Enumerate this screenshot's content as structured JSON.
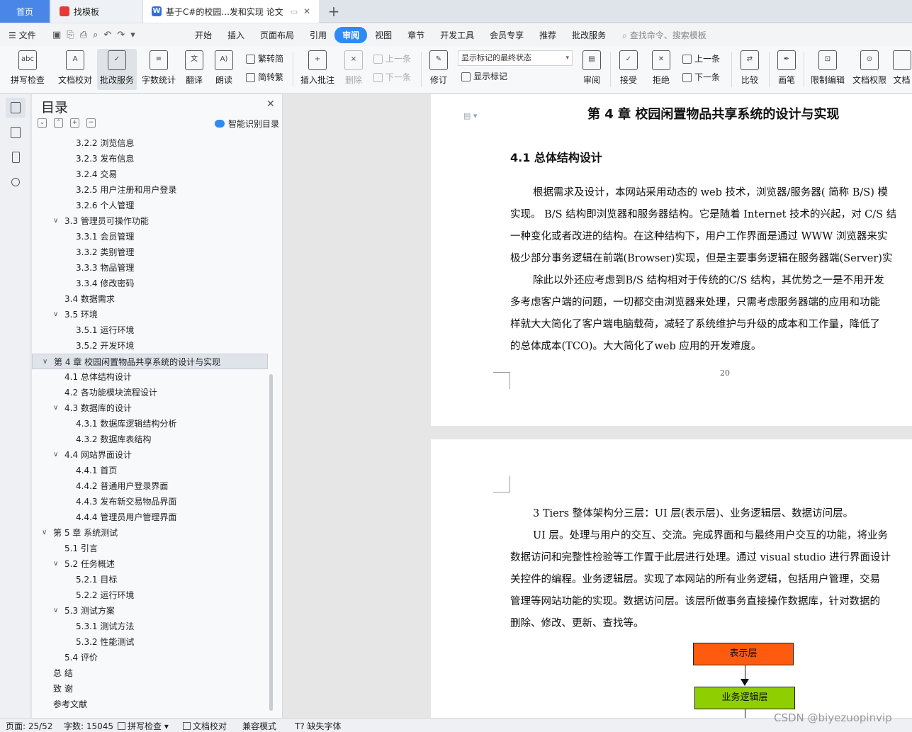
{
  "tabs": {
    "home": "首页",
    "template": "找模板",
    "document": "基于C#的校园...发和实现 论文"
  },
  "menubar": {
    "file": "文件",
    "items": [
      "开始",
      "插入",
      "页面布局",
      "引用",
      "审阅",
      "视图",
      "章节",
      "开发工具",
      "会员专享",
      "推荐",
      "批改服务"
    ],
    "active": "审阅",
    "search_placeholder": "查找命令、搜索模板"
  },
  "ribbon": {
    "spellcheck": "拼写检查",
    "doc_proof": "文档校对",
    "correct_service": "批改服务",
    "word_count": "字数统计",
    "translate": "翻译",
    "read_aloud": "朗读",
    "trad_conv": "繁转简",
    "simp_conv": "简转繁",
    "insert_comment": "插入批注",
    "delete": "删除",
    "prev_comment": "上一条",
    "next_comment": "下一条",
    "track": "修订",
    "markup_select": "显示标记的最终状态",
    "show_markup": "显示标记",
    "review": "审阅",
    "accept": "接受",
    "reject": "拒绝",
    "prev": "上一条",
    "next": "下一条",
    "compare": "比较",
    "pen": "画笔",
    "restrict_edit": "限制编辑",
    "doc_permission": "文档权限",
    "doc_more": "文档"
  },
  "toc": {
    "title": "目录",
    "smart": "智能识别目录",
    "items": [
      {
        "label": "3.2.2 浏览信息",
        "level": 3
      },
      {
        "label": "3.2.3 发布信息",
        "level": 3
      },
      {
        "label": "3.2.4  交易",
        "level": 3
      },
      {
        "label": "3.2.5 用户注册和用户登录",
        "level": 3
      },
      {
        "label": "3.2.6 个人管理",
        "level": 3
      },
      {
        "label": "3.3 管理员可操作功能",
        "level": 2,
        "expand": true
      },
      {
        "label": "3.3.1 会员管理",
        "level": 3
      },
      {
        "label": "3.3.2 类别管理",
        "level": 3
      },
      {
        "label": "3.3.3 物品管理",
        "level": 3
      },
      {
        "label": "3.3.4  修改密码",
        "level": 3
      },
      {
        "label": "3.4 数据需求",
        "level": 2
      },
      {
        "label": "3.5 环境",
        "level": 2,
        "expand": true
      },
      {
        "label": "3.5.1 运行环境",
        "level": 3
      },
      {
        "label": "3.5.2 开发环境",
        "level": 3
      },
      {
        "label": "第 4 章  校园闲置物品共享系统的设计与实现",
        "level": 1,
        "expand": true,
        "selected": true
      },
      {
        "label": "4.1 总体结构设计",
        "level": 2
      },
      {
        "label": "4.2 各功能模块流程设计",
        "level": 2
      },
      {
        "label": "4.3 数据库的设计",
        "level": 2,
        "expand": true
      },
      {
        "label": "4.3.1 数据库逻辑结构分析",
        "level": 3
      },
      {
        "label": "4.3.2 数据库表结构",
        "level": 3
      },
      {
        "label": "4.4 网站界面设计",
        "level": 2,
        "expand": true
      },
      {
        "label": "4.4.1 首页",
        "level": 3
      },
      {
        "label": "4.4.2 普通用户登录界面",
        "level": 3
      },
      {
        "label": "4.4.3 发布新交易物品界面",
        "level": 3
      },
      {
        "label": "4.4.4 管理员用户管理界面",
        "level": 3
      },
      {
        "label": "第 5 章  系统测试",
        "level": 1,
        "expand": true
      },
      {
        "label": "5.1  引言",
        "level": 2
      },
      {
        "label": "5.2  任务概述",
        "level": 2,
        "expand": true
      },
      {
        "label": "5.2.1  目标",
        "level": 3
      },
      {
        "label": "5.2.2  运行环境",
        "level": 3
      },
      {
        "label": "5.3  测试方案",
        "level": 2,
        "expand": true
      },
      {
        "label": "5.3.1  测试方法",
        "level": 3
      },
      {
        "label": "5.3.2  性能测试",
        "level": 3
      },
      {
        "label": "5.4  评价",
        "level": 2
      },
      {
        "label": "总    结",
        "level": 1
      },
      {
        "label": "致    谢",
        "level": 1
      },
      {
        "label": "参考文献",
        "level": 1
      }
    ]
  },
  "page1": {
    "chapter_title": "第 4 章  校园闲置物品共享系统的设计与实现",
    "section_title": "4.1 总体结构设计",
    "lines": [
      "根据需求及设计，本网站采用动态的 web 技术，浏览器/服务器( 简称 B/S) 模",
      "实现。  B/S 结构即浏览器和服务器结构。它是随着 Internet 技术的兴起，对 C/S 结",
      "一种变化或者改进的结构。在这种结构下，用户工作界面是通过 WWW 浏览器来实",
      "极少部分事务逻辑在前端(Browser)实现，但是主要事务逻辑在服务器端(Server)实",
      "除此以外还应考虑到B/S  结构相对于传统的C/S  结构，其优势之一是不用开发",
      "多考虑客户端的问题，一切都交由浏览器来处理，只需考虑服务器端的应用和功能",
      "样就大大简化了客户端电脑载荷，减轻了系统维护与升级的成本和工作量，降低了",
      "的总体成本(TCO)。大大简化了web  应用的开发难度。"
    ],
    "page_number": "20"
  },
  "page2": {
    "lines": [
      "3 Tiers 整体架构分三层：UI 层(表示层)、业务逻辑层、数据访问层。",
      "UI 层。处理与用户的交互、交流。完成界面和与最终用户交互的功能，将业务",
      "数据访问和完整性检验等工作置于此层进行处理。通过 visual  studio 进行界面设计",
      "关控件的编程。业务逻辑层。实现了本网站的所有业务逻辑，包括用户管理，交易",
      "管理等网站功能的实现。数据访问层。该层所做事务直接操作数据库，针对数据的",
      "删除、修改、更新、查找等。"
    ],
    "diagram": {
      "top_box": "表示层",
      "middle_box": "业务逻辑层",
      "top_color": "#ff5b0f",
      "middle_color": "#8fce00"
    }
  },
  "status": {
    "page": "页面: 25/52",
    "words": "字数: 15045",
    "spellcheck": "拼写检查",
    "proof": "文档校对",
    "compat": "兼容模式",
    "missing_font": "缺失字体"
  },
  "watermark": "CSDN @biyezuopinvip",
  "colors": {
    "accent": "#2f8af5",
    "home_tab": "#4a86e8"
  }
}
